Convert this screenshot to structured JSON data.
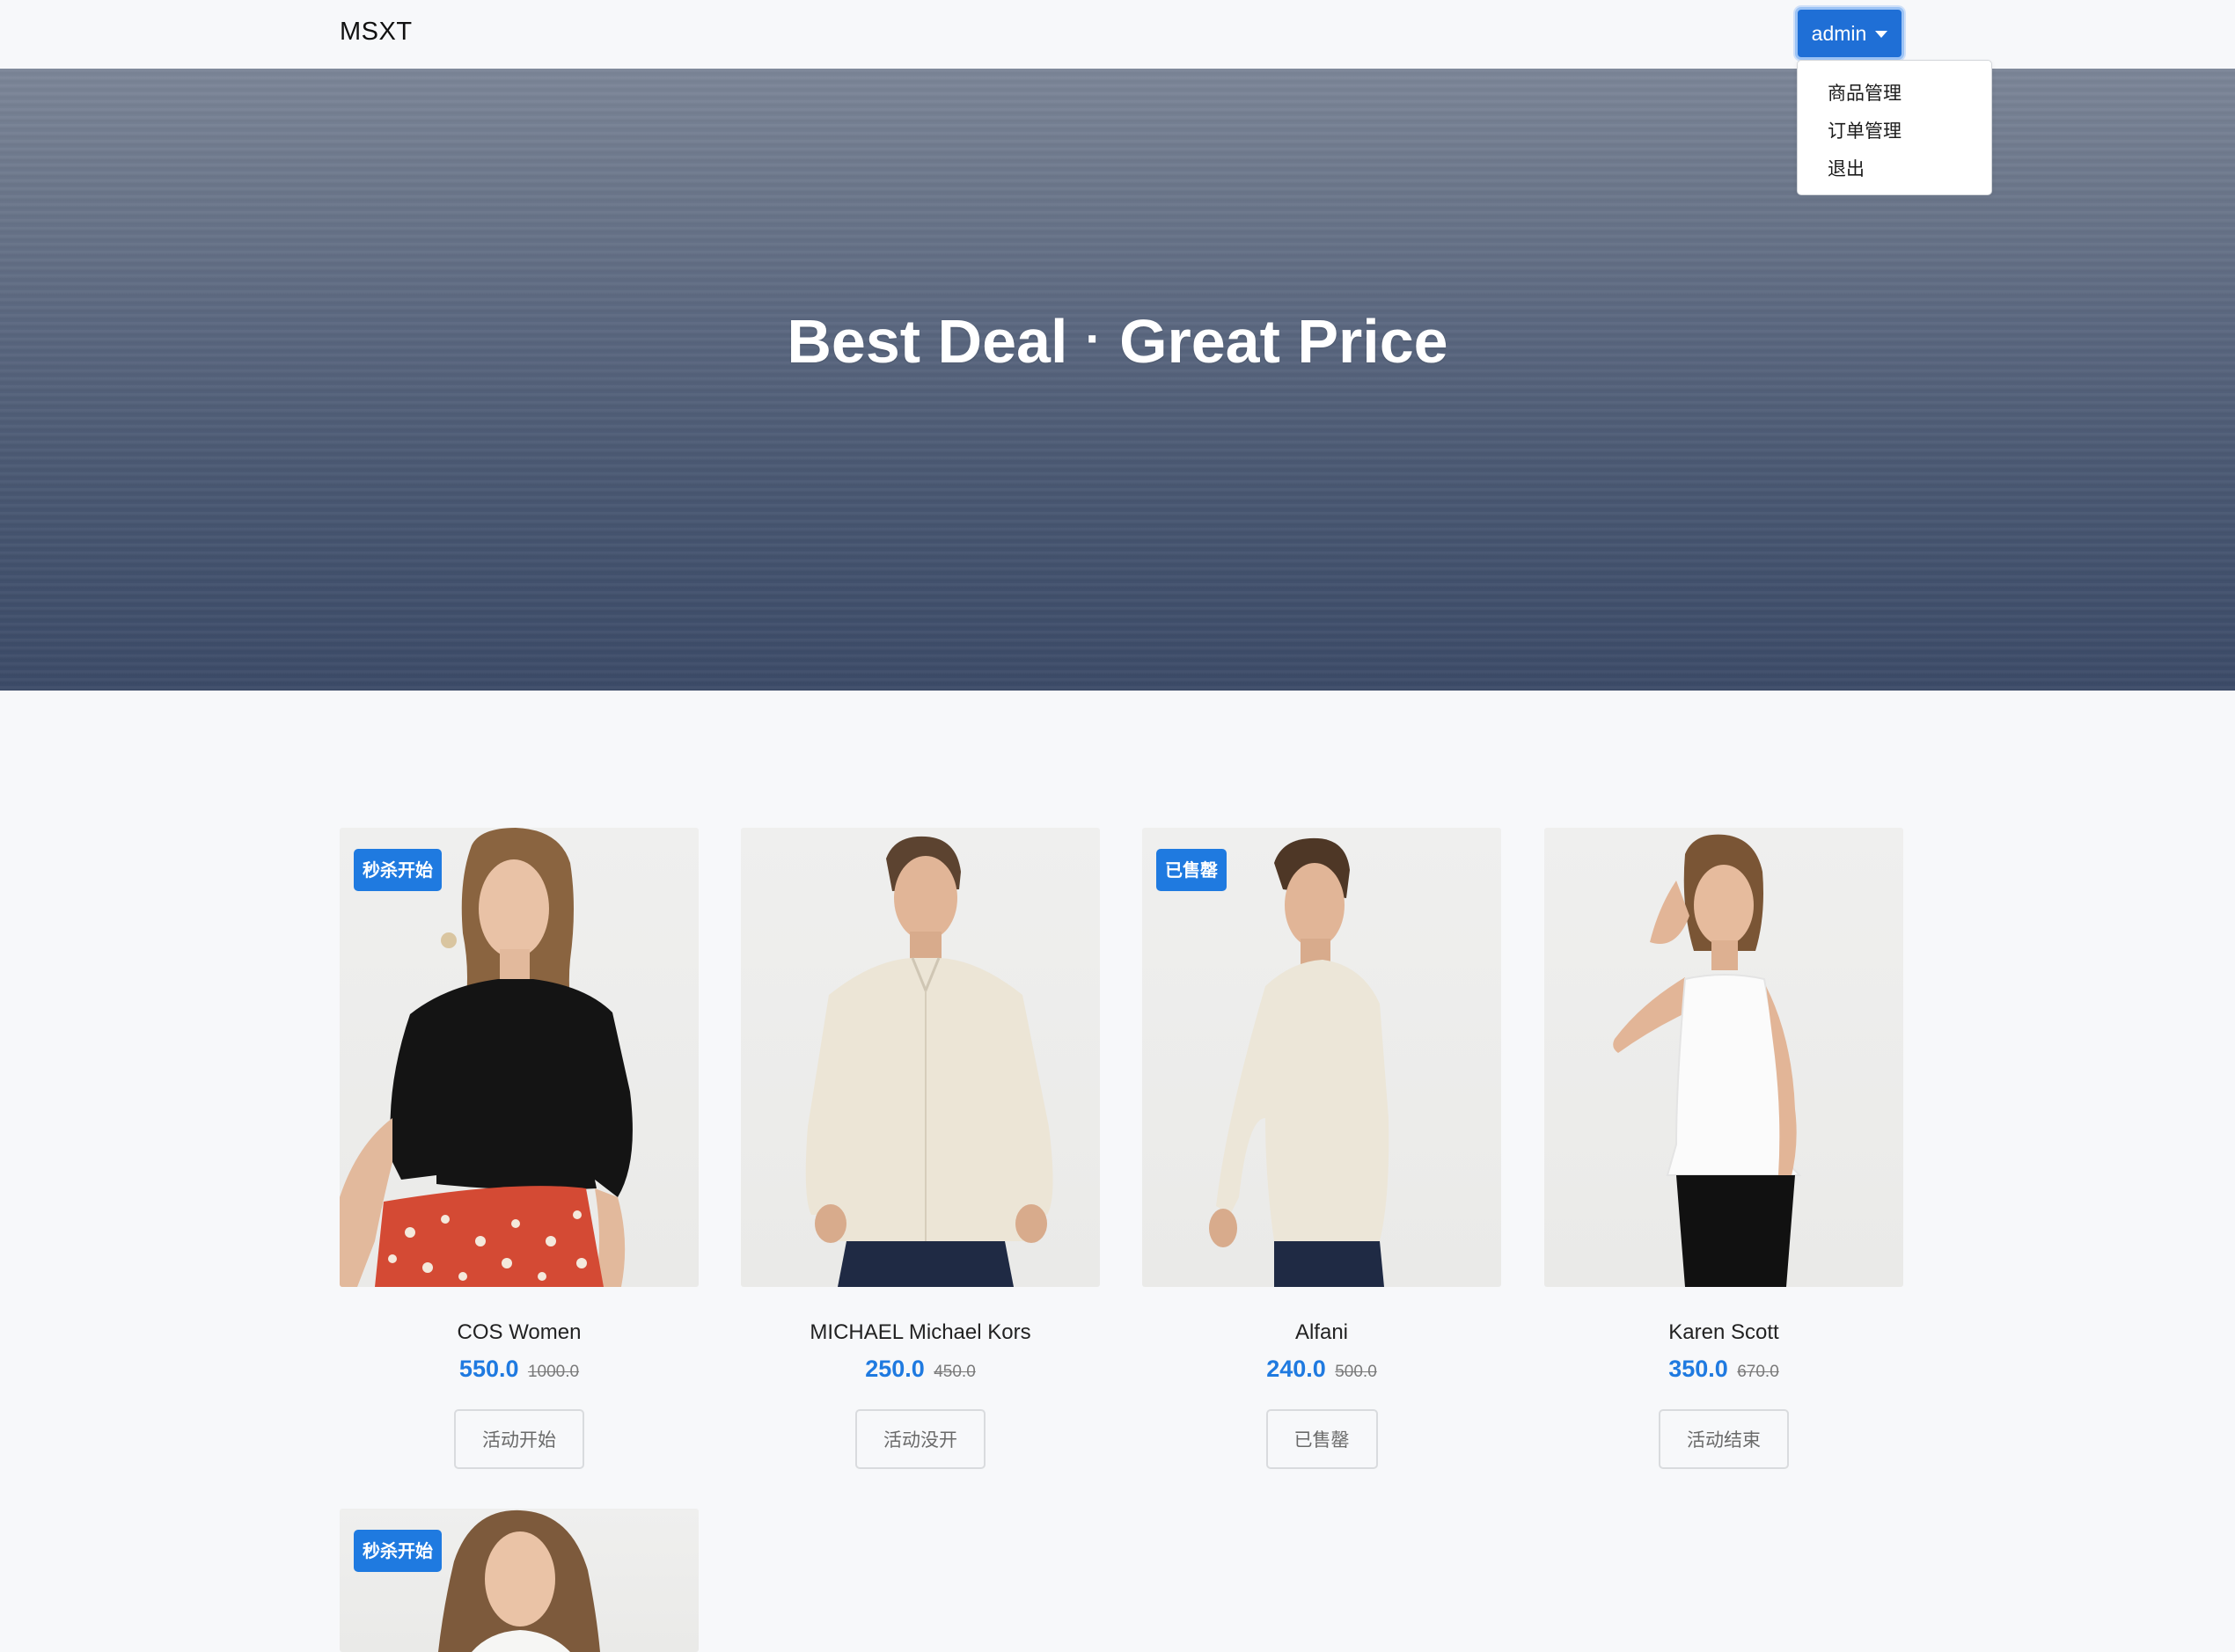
{
  "nav": {
    "brand": "MSXT",
    "user_button": "admin",
    "dropdown": [
      "商品管理",
      "订单管理",
      "退出"
    ]
  },
  "hero": {
    "title_left": "Best Deal",
    "separator": "·",
    "title_right": "Great Price"
  },
  "colors": {
    "accent": "#1f7ae0",
    "button_primary": "#1f6fd6",
    "background": "#f7f8fa"
  },
  "products": [
    {
      "badge": "秒杀开始",
      "name": "COS Women",
      "price": "550.0",
      "original_price": "1000.0",
      "action": "活动开始"
    },
    {
      "badge": "",
      "name": "MICHAEL Michael Kors",
      "price": "250.0",
      "original_price": "450.0",
      "action": "活动没开"
    },
    {
      "badge": "已售罄",
      "name": "Alfani",
      "price": "240.0",
      "original_price": "500.0",
      "action": "已售罄"
    },
    {
      "badge": "",
      "name": "Karen Scott",
      "price": "350.0",
      "original_price": "670.0",
      "action": "活动结束"
    },
    {
      "badge": "秒杀开始",
      "name": "",
      "price": "",
      "original_price": "",
      "action": ""
    }
  ]
}
